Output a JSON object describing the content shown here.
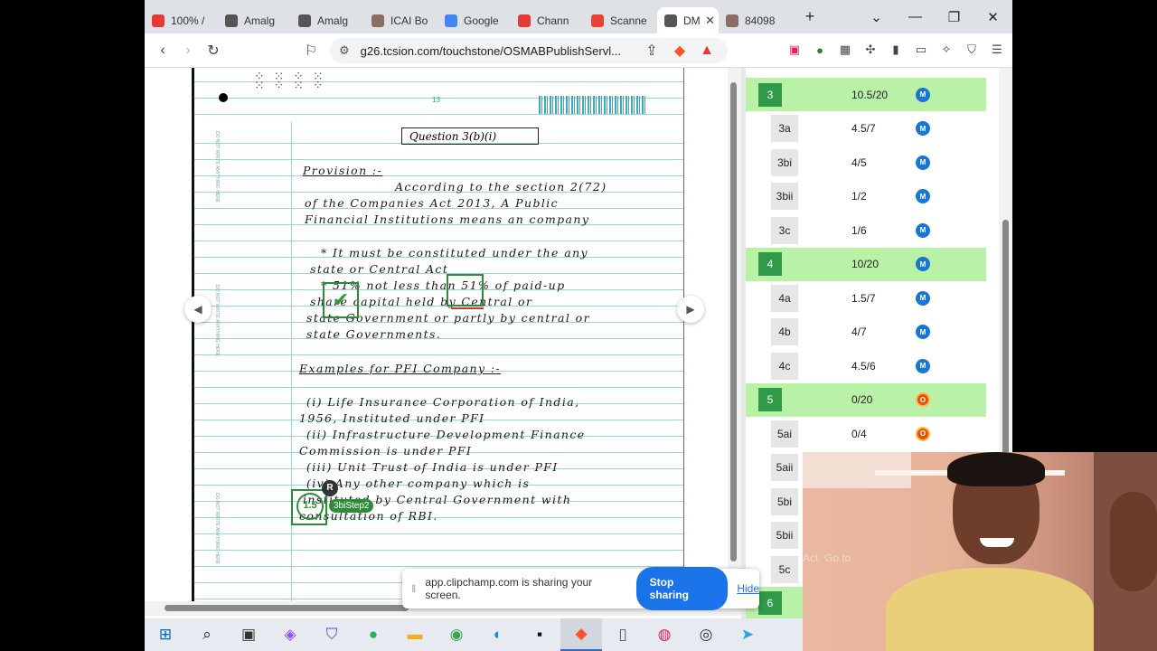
{
  "browser": {
    "tabs": [
      {
        "label": "100% /",
        "color": "#e53935"
      },
      {
        "label": "Amalg",
        "color": "#555555"
      },
      {
        "label": "Amalg",
        "color": "#555555"
      },
      {
        "label": "ICAI Bo",
        "color": "#8d6e63"
      },
      {
        "label": "Google",
        "color": "#4285f4"
      },
      {
        "label": "Chann",
        "color": "#e53935"
      },
      {
        "label": "Scanne",
        "color": "#ea4335"
      },
      {
        "label": "DM",
        "color": "#555555",
        "active": true
      },
      {
        "label": "84098",
        "color": "#8d6e63"
      }
    ],
    "url": "g26.tcsion.com/touchstone/OSMABPublishServl..."
  },
  "answer_sheet": {
    "page_number": "13",
    "question_box": "Question 3(b)(i)",
    "lines": [
      {
        "text": "Provision :-",
        "underline": true
      },
      {
        "text": "According to the section 2(72)"
      },
      {
        "text": "of the Companies Act 2013, A Public"
      },
      {
        "text": "Financial Institutions means an company"
      },
      {
        "text": "* It must be constituted under the any"
      },
      {
        "text": "state or Central Act"
      },
      {
        "text": "* 51% not less than 51% of paid-up"
      },
      {
        "text": "share capital held by Central or"
      },
      {
        "text": "state Government or partly by central or"
      },
      {
        "text": "state Governments."
      },
      {
        "text": "Examples for PFI Company :-",
        "underline": true
      },
      {
        "text": "(i) Life Insurance Corporation of India,"
      },
      {
        "text": "1956, Instituted under PFI"
      },
      {
        "text": "(ii) Infrastructure Development Finance"
      },
      {
        "text": "Commission is under PFI"
      },
      {
        "text": "(iii) Unit Trust of India is under PFI"
      },
      {
        "text": "(iv) Any other company which is"
      },
      {
        "text": "instituted by Central Government with"
      },
      {
        "text": "consultation of RBI."
      }
    ],
    "margin_note": "DO NOT WRITE ANYTHING HERE",
    "score_badge": {
      "value": "1.5",
      "reviewer": "R",
      "step": "3biStep2"
    }
  },
  "marks_panel": {
    "rows": [
      {
        "label": "3",
        "marks": "10.5/20",
        "badge": "M",
        "main": true
      },
      {
        "label": "3a",
        "marks": "4.5/7",
        "badge": "M"
      },
      {
        "label": "3bi",
        "marks": "4/5",
        "badge": "M"
      },
      {
        "label": "3bii",
        "marks": "1/2",
        "badge": "M"
      },
      {
        "label": "3c",
        "marks": "1/6",
        "badge": "M"
      },
      {
        "label": "4",
        "marks": "10/20",
        "badge": "M",
        "main": true
      },
      {
        "label": "4a",
        "marks": "1.5/7",
        "badge": "M"
      },
      {
        "label": "4b",
        "marks": "4/7",
        "badge": "M"
      },
      {
        "label": "4c",
        "marks": "4.5/6",
        "badge": "M"
      },
      {
        "label": "5",
        "marks": "0/20",
        "badge": "O",
        "main": true
      },
      {
        "label": "5ai",
        "marks": "0/4",
        "badge": "O"
      },
      {
        "label": "5aii",
        "marks": "",
        "badge": ""
      },
      {
        "label": "5bi",
        "marks": "",
        "badge": ""
      },
      {
        "label": "5bii",
        "marks": "",
        "badge": ""
      },
      {
        "label": "5c",
        "marks": "",
        "badge": ""
      },
      {
        "label": "6",
        "marks": "",
        "badge": "",
        "main": true
      }
    ]
  },
  "share_bar": {
    "message": "app.clipchamp.com is sharing your screen.",
    "stop_label": "Stop sharing",
    "hide_label": "Hide"
  },
  "webcam": {
    "watermark": "Act  Go to"
  },
  "taskbar": {
    "icons": [
      "windows-start",
      "search",
      "task-view",
      "copilot",
      "brave-shield",
      "spotify",
      "file-explorer",
      "chrome",
      "edge",
      "pycharm",
      "brave",
      "notepad",
      "paint",
      "obs",
      "telegram"
    ]
  }
}
